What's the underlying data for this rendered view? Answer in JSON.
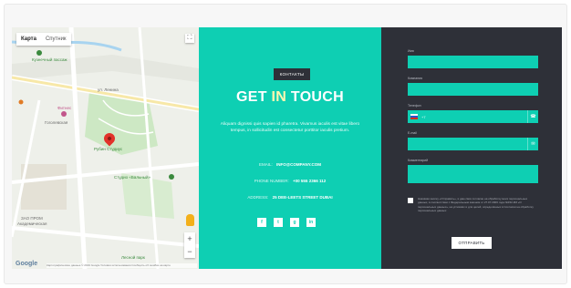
{
  "map": {
    "tabs": [
      {
        "label": "Карта",
        "active": true
      },
      {
        "label": "Спутник",
        "active": false
      }
    ],
    "labels": [
      {
        "text": "Кузнечный пассаж",
        "kind": "place"
      },
      {
        "text": "Гоголевская",
        "kind": "place"
      },
      {
        "text": "Фитнес",
        "kind": "poi"
      },
      {
        "text": "Рубин Студиус",
        "kind": "poi"
      },
      {
        "text": "Студио «Бальный»",
        "kind": "park"
      },
      {
        "text": "ул. Ленина",
        "kind": "street"
      },
      {
        "text": "ЗАО ПРОМ",
        "kind": "place"
      },
      {
        "text": "Академическая",
        "kind": "place"
      },
      {
        "text": "Лесной парк",
        "kind": "park"
      }
    ],
    "google_label": "Google",
    "footer_text": "Картографические данные © 2019 Google   Условия использования   Сообщить об ошибке на карте",
    "zoom_in": "+",
    "zoom_out": "−",
    "fullscreen_icon": "fullscreen-icon",
    "colors": {
      "road": "#ffffff",
      "park": "#cde8c4",
      "block": "#e9ebe4"
    }
  },
  "info": {
    "badge": "КОНТАКТЫ",
    "title_part1": "GET ",
    "title_part2": "IN ",
    "title_part3": "TOUCH",
    "description": "Aliquam dignissi quis sapien id pharetra. Vivamus iaculis est vitae libero tempus, in sollicitudin est consectetur porttitor iaculis pretium.",
    "email_label": "EMAIL:",
    "email_value": "INFO@COMPANY.COM",
    "phone_label": "PHONE NUMBER:",
    "phone_value": "+00 555 2366 112",
    "address_label": "ADDRESS:",
    "address_value": "25 DEE-LEETS STREET DUBAI",
    "socials": [
      "f",
      "t",
      "g",
      "in"
    ],
    "colors": {
      "accent": "#0ecfb3",
      "title_highlight": "#fff7b0"
    }
  },
  "form": {
    "name_label": "Имя",
    "company_label": "Компания",
    "phone_label": "Телефон",
    "phone_code": "+7",
    "email_label": "E-mail",
    "comment_label": "Комментарий",
    "consent_text": "Нажимая кнопку «Отправить», я даю своё согласие на обработку моих персональных данных, в соответствии с Федеральным законом от 27.07.2006 года №152-ФЗ «О персональных данных», на условиях и для целей, определённых в Согласии на обработку персональных данных",
    "submit_label": "ОТПРАВИТЬ",
    "colors": {
      "background": "#2e3038",
      "field": "#0ecfb3"
    }
  }
}
